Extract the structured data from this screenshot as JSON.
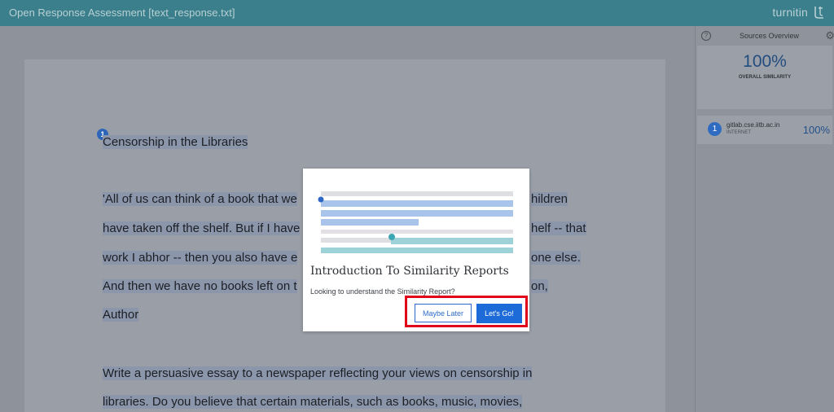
{
  "header": {
    "title": "Open Response Assessment [text_response.txt]",
    "brand": "turnitin"
  },
  "document": {
    "marker": "1",
    "lines": [
      "Censorship in the Libraries",
      "'All of us can think of a book that we",
      "hildren",
      "have taken off the shelf. But if I have",
      "helf -- that",
      "work I abhor -- then you also have e",
      "one else.",
      "And then we have no books left on t",
      "on,",
      "Author",
      "Write a persuasive essay to a newspaper reflecting your views on censorship in",
      "libraries. Do you believe that certain materials, such as books, music, movies,"
    ]
  },
  "sidebar": {
    "title": "Sources Overview",
    "overall_percent": "100%",
    "overall_label": "OVERALL SIMILARITY",
    "sources": [
      {
        "number": "1",
        "name": "gitlab.cse.iitb.ac.in",
        "type": "INTERNET",
        "percent": "100%"
      }
    ]
  },
  "modal": {
    "title": "Introduction To Similarity Reports",
    "body": "Looking to understand the Similarity Report?",
    "later_label": "Maybe Later",
    "go_label": "Let's Go!"
  },
  "colors": {
    "topbar": "#3a7f8b",
    "primary_button": "#1d6ad9",
    "highlight_box": "#e0001a"
  }
}
